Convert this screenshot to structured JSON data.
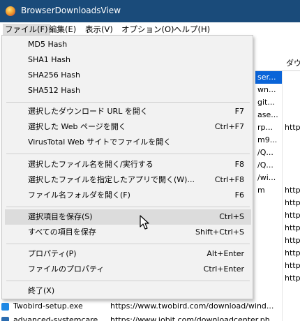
{
  "window": {
    "title": "BrowserDownloadsView"
  },
  "menubar": {
    "items": [
      "ファイル(F)",
      "編集(E)",
      "表示(V)",
      "オプション(O)",
      "ヘルプ(H)"
    ]
  },
  "list": {
    "header_right": "ダウン",
    "rows": [
      {
        "b": "ser...",
        "c": ""
      },
      {
        "b": "wn...",
        "c": ""
      },
      {
        "b": "git...",
        "c": ""
      },
      {
        "b": "ase...",
        "c": ""
      },
      {
        "b": "rp...",
        "c": "http"
      },
      {
        "b": "m9...",
        "c": ""
      },
      {
        "b": "/Q...",
        "c": ""
      },
      {
        "b": "/Q...",
        "c": ""
      },
      {
        "b": "/wi...",
        "c": ""
      },
      {
        "b": "m",
        "c": "http"
      },
      {
        "b": "",
        "c": "http"
      },
      {
        "b": "",
        "c": "http"
      },
      {
        "b": "",
        "c": "http"
      },
      {
        "b": "",
        "c": "http"
      },
      {
        "b": "",
        "c": "http"
      },
      {
        "b": "",
        "c": "http"
      },
      {
        "b": "",
        "c": "http"
      }
    ],
    "bottom_rows": [
      {
        "name": "Twobird-setup.exe",
        "url": "https://www.twobird.com/download/wind..."
      },
      {
        "name": "advanced-systemcare...",
        "url": "https://www.iobit.com/downloadcenter.ph..."
      }
    ]
  },
  "file_menu": {
    "items": [
      {
        "label": "MD5 Hash",
        "shortcut": ""
      },
      {
        "label": "SHA1 Hash",
        "shortcut": ""
      },
      {
        "label": "SHA256 Hash",
        "shortcut": ""
      },
      {
        "label": "SHA512 Hash",
        "shortcut": ""
      },
      {
        "label": "選択したダウンロード URL を開く",
        "shortcut": "F7"
      },
      {
        "label": "選択した Web ページを開く",
        "shortcut": "Ctrl+F7"
      },
      {
        "label": "VirusTotal Web サイトでファイルを開く",
        "shortcut": ""
      },
      {
        "label": "選択したファイル名を開く/実行する",
        "shortcut": "F8"
      },
      {
        "label": "選択したファイルを指定したアプリで開く(W)...",
        "shortcut": "Ctrl+F8"
      },
      {
        "label": "ファイル名フォルダを開く(F)",
        "shortcut": "F6"
      },
      {
        "label": "選択項目を保存(S)",
        "shortcut": "Ctrl+S"
      },
      {
        "label": "すべての項目を保存",
        "shortcut": "Shift+Ctrl+S"
      },
      {
        "label": "プロパティ(P)",
        "shortcut": "Alt+Enter"
      },
      {
        "label": "ファイルのプロパティ",
        "shortcut": "Ctrl+Enter"
      },
      {
        "label": "終了(X)",
        "shortcut": ""
      }
    ]
  },
  "colors": {
    "titlebar": "#1a4b7a",
    "selection": "#0a64d8",
    "menu_bg": "#f2f2f2",
    "hover": "#dcdcdc"
  }
}
